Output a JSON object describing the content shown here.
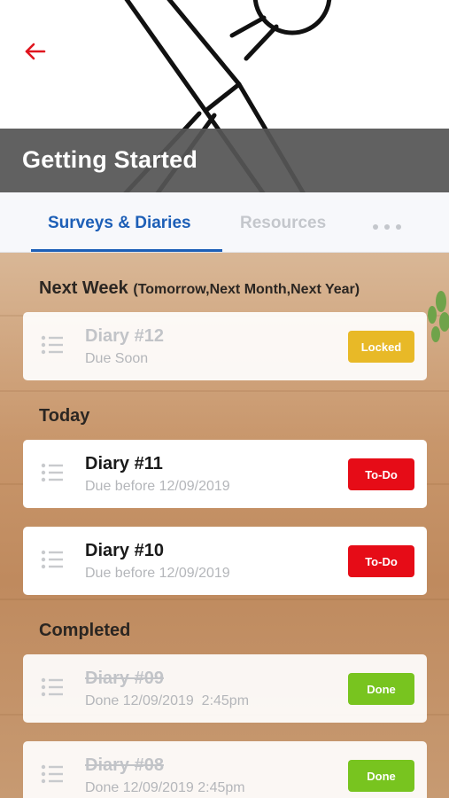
{
  "header": {
    "title": "Getting Started",
    "back_icon": "arrow-left-icon",
    "back_color": "#e0141e"
  },
  "tabs": [
    {
      "label": "Surveys & Diaries",
      "active": true
    },
    {
      "label": "Resources",
      "active": false
    }
  ],
  "more_icon": "more-dots-icon",
  "colors": {
    "accent": "#1d5fb7",
    "locked": "#e8b927",
    "todo": "#e60c17",
    "done": "#78c41f"
  },
  "sections": [
    {
      "heading": "Next Week",
      "subheading": "(Tomorrow,Next Month,Next Year)",
      "items": [
        {
          "name": "Diary #12",
          "due": "Due Soon",
          "status": "Locked"
        }
      ]
    },
    {
      "heading": "Today",
      "items": [
        {
          "name": "Diary #11",
          "due": "Due before 12/09/2019",
          "status": "To-Do"
        },
        {
          "name": "Diary #10",
          "due": "Due before 12/09/2019",
          "status": "To-Do"
        }
      ]
    },
    {
      "heading": "Completed",
      "items": [
        {
          "name": "Diary #09",
          "due": "Done 12/09/2019  2:45pm",
          "status": "Done"
        },
        {
          "name": "Diary #08",
          "due": "Done 12/09/2019 2:45pm",
          "status": "Done"
        }
      ]
    }
  ]
}
